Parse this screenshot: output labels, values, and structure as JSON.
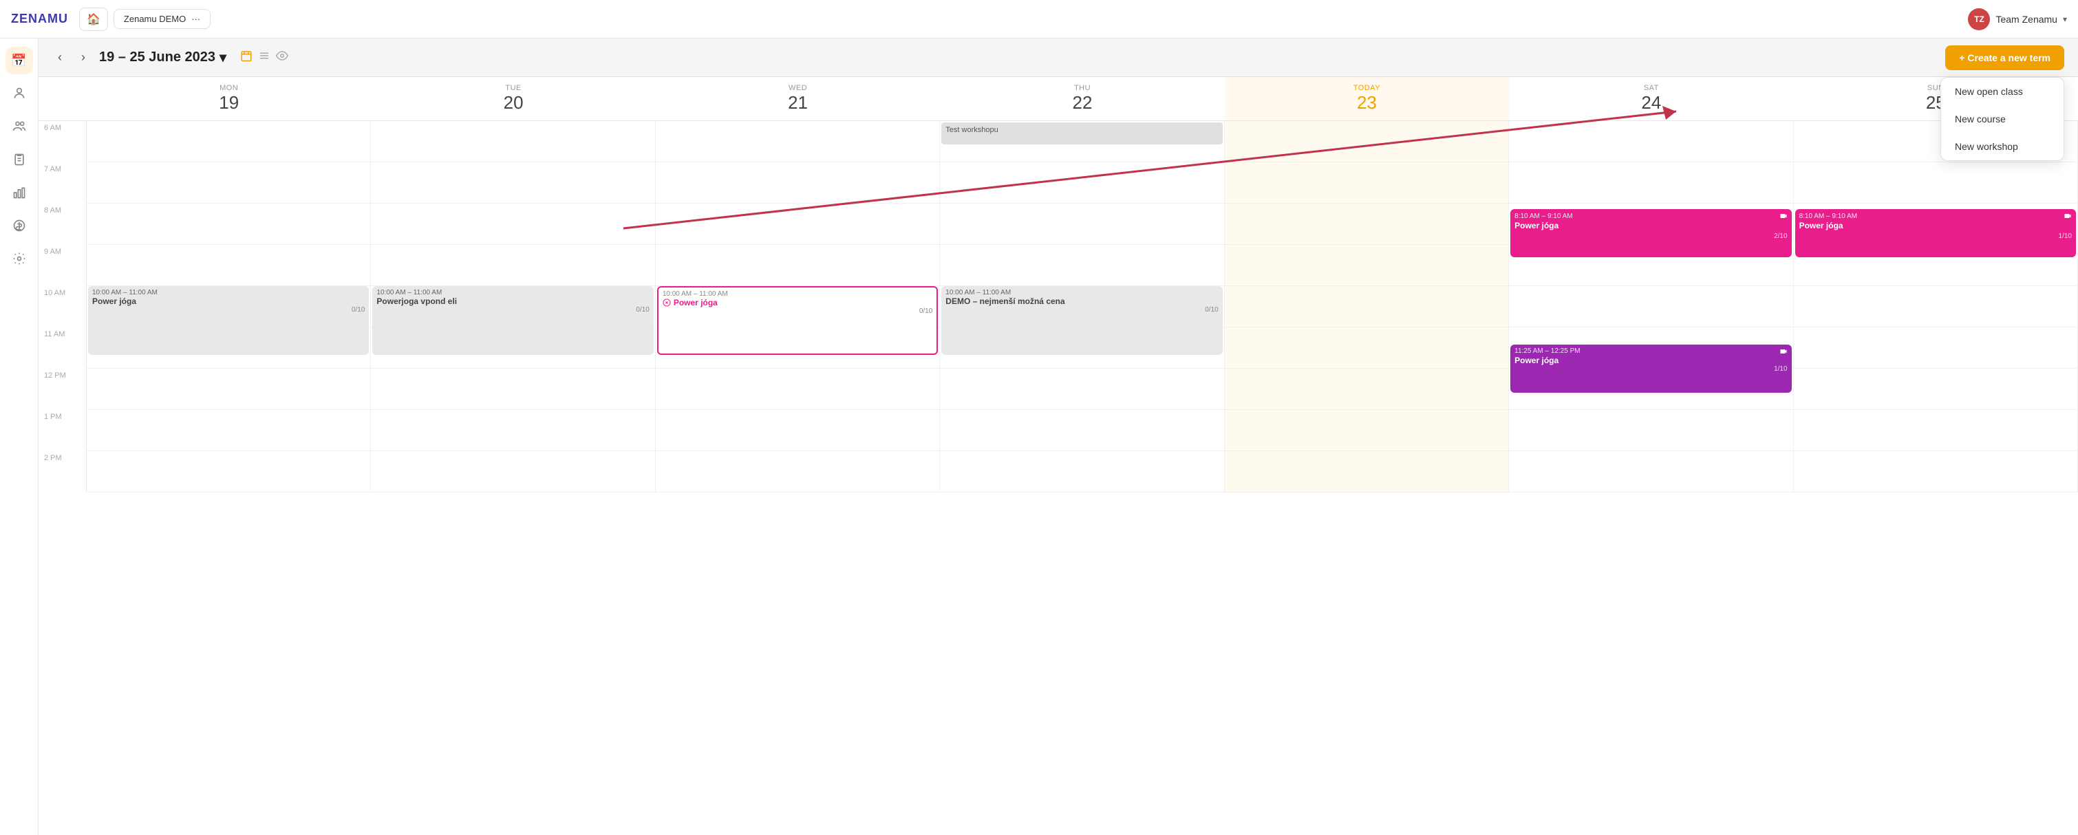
{
  "topbar": {
    "logo": "ZENAMU",
    "home_icon": "🏠",
    "demo_label": "Zenamu DEMO",
    "more_icon": "···",
    "user_name": "Team Zenamu",
    "user_initials": "TZ",
    "chevron": "▾"
  },
  "sidebar": {
    "items": [
      {
        "id": "calendar",
        "icon": "📅",
        "active": true
      },
      {
        "id": "person",
        "icon": "👤"
      },
      {
        "id": "group",
        "icon": "👥"
      },
      {
        "id": "clipboard",
        "icon": "📋"
      },
      {
        "id": "chart",
        "icon": "📊"
      },
      {
        "id": "dollar",
        "icon": "💲"
      },
      {
        "id": "settings",
        "icon": "⚙️"
      }
    ]
  },
  "toolbar": {
    "nav_prev": "‹",
    "nav_next": "›",
    "date_range": "19 – 25 June 2023",
    "date_chevron": "▾",
    "create_btn": "+ Create a new term"
  },
  "dropdown": {
    "items": [
      {
        "label": "New open class"
      },
      {
        "label": "New course"
      },
      {
        "label": "New workshop"
      }
    ]
  },
  "calendar": {
    "days": [
      {
        "label": "MON",
        "num": "19",
        "today": false
      },
      {
        "label": "TUE",
        "num": "20",
        "today": false
      },
      {
        "label": "WED",
        "num": "21",
        "today": false
      },
      {
        "label": "THU",
        "num": "22",
        "today": false
      },
      {
        "label": "TODAY",
        "num": "23",
        "today": true
      },
      {
        "label": "SAT",
        "num": "24",
        "today": false
      },
      {
        "label": "SUN",
        "num": "25",
        "today": false
      }
    ],
    "time_slots": [
      "6 AM",
      "7 AM",
      "8 AM",
      "9 AM",
      "10 AM",
      "11 AM",
      "12 PM",
      "1 PM",
      "2 PM"
    ],
    "events": [
      {
        "id": "workshop-thu",
        "col": 4,
        "row_start": 0,
        "top_pct": 0,
        "height": 34,
        "title": "Test workshopu",
        "style": "grey"
      },
      {
        "id": "power-joga-sat1",
        "col": 6,
        "row_start": 3,
        "top_pct": 10,
        "height": 44,
        "time": "8:10 AM – 9:10 AM",
        "title": "Power jóga",
        "count": "2/10",
        "style": "pink",
        "camera": true
      },
      {
        "id": "power-joga-sun1",
        "col": 7,
        "row_start": 3,
        "top_pct": 10,
        "height": 44,
        "time": "8:10 AM – 9:10 AM",
        "title": "Power jóga",
        "count": "1/10",
        "style": "pink",
        "camera": true
      },
      {
        "id": "power-joga-mon",
        "col": 1,
        "row_start": 5,
        "top_pct": 0,
        "height": 50,
        "time": "10:00 AM – 11:00 AM",
        "title": "Power jóga",
        "count": "0/10",
        "style": "grey-light"
      },
      {
        "id": "powerjoga-vpond-tue",
        "col": 2,
        "row_start": 5,
        "top_pct": 0,
        "height": 50,
        "time": "10:00 AM – 11:00 AM",
        "title": "Powerjoga vpond eli",
        "count": "0/10",
        "style": "grey-light"
      },
      {
        "id": "power-joga-wed",
        "col": 3,
        "row_start": 5,
        "top_pct": 0,
        "height": 50,
        "time": "10:00 AM – 11:00 AM",
        "title": "Power jóga",
        "count": "0/10",
        "style": "red-border"
      },
      {
        "id": "demo-wed",
        "col": 4,
        "row_start": 5,
        "top_pct": 0,
        "height": 50,
        "time": "10:00 AM – 11:00 AM",
        "title": "DEMO – nejmenší možná cena",
        "count": "0/10",
        "style": "grey-light"
      },
      {
        "id": "power-joga-sat2",
        "col": 6,
        "row_start": 6,
        "top_pct": 25,
        "height": 50,
        "time": "11:25 AM – 12:25 PM",
        "title": "Power jóga",
        "count": "1/10",
        "style": "purple",
        "camera": true
      }
    ]
  }
}
